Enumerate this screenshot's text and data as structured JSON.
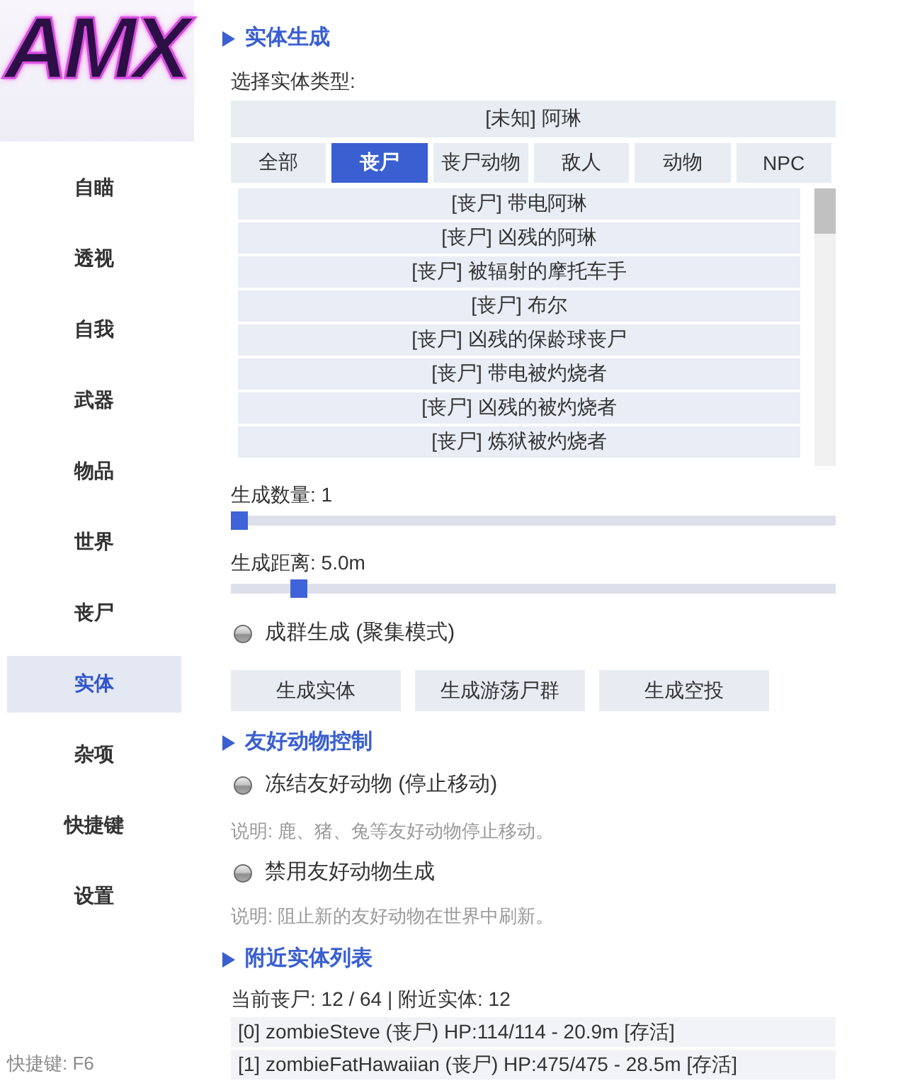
{
  "logo": {
    "text": "AMX"
  },
  "sidebar": {
    "items": [
      {
        "label": "自瞄",
        "selected": false
      },
      {
        "label": "透视",
        "selected": false
      },
      {
        "label": "自我",
        "selected": false
      },
      {
        "label": "武器",
        "selected": false
      },
      {
        "label": "物品",
        "selected": false
      },
      {
        "label": "世界",
        "selected": false
      },
      {
        "label": "丧尸",
        "selected": false
      },
      {
        "label": "实体",
        "selected": true
      },
      {
        "label": "杂项",
        "selected": false
      },
      {
        "label": "快捷键",
        "selected": false
      },
      {
        "label": "设置",
        "selected": false
      }
    ],
    "hotkey_hint": "快捷键: F6"
  },
  "spawn_section": {
    "title": "实体生成",
    "type_label": "选择实体类型:",
    "current_selection": "[未知] 阿琳",
    "tabs": [
      {
        "label": "全部",
        "selected": false
      },
      {
        "label": "丧尸",
        "selected": true
      },
      {
        "label": "丧尸动物",
        "selected": false
      },
      {
        "label": "敌人",
        "selected": false
      },
      {
        "label": "动物",
        "selected": false
      },
      {
        "label": "NPC",
        "selected": false
      }
    ],
    "entities": [
      {
        "label": "[丧尸] 带电阿琳",
        "selected": false
      },
      {
        "label": "[丧尸] 凶残的阿琳",
        "selected": false
      },
      {
        "label": "[丧尸] 被辐射的摩托车手",
        "selected": false
      },
      {
        "label": "[丧尸] 布尔",
        "selected": false
      },
      {
        "label": "[丧尸] 凶残的保龄球丧尸",
        "selected": false
      },
      {
        "label": "[丧尸] 带电被灼烧者",
        "selected": false
      },
      {
        "label": "[丧尸] 凶残的被灼烧者",
        "selected": false
      },
      {
        "label": "[丧尸] 炼狱被灼烧者",
        "selected": false
      }
    ],
    "sliders": [
      {
        "label": "生成数量: 1",
        "level": 0
      },
      {
        "label": "生成距离: 5.0m",
        "level": 0.1
      }
    ],
    "options": [
      {
        "label": "成群生成 (聚集模式)",
        "checked": false
      }
    ],
    "buttons": [
      "生成实体",
      "生成游荡尸群",
      "生成空投"
    ]
  },
  "friendly_section": {
    "title": "友好动物控制",
    "options": [
      {
        "label": "冻结友好动物 (停止移动)",
        "checked": false,
        "note": "说明: 鹿、猪、兔等友好动物停止移动。"
      },
      {
        "label": "禁用友好动物生成",
        "checked": false,
        "note": "说明: 阻止新的友好动物在世界中刷新。"
      }
    ]
  },
  "nearby_section": {
    "title": "附近实体列表",
    "summary": "当前丧尸: 12 / 64 | 附近实体: 12",
    "rows": [
      "[0] zombieSteve (丧尸) HP:114/114 - 20.9m [存活]",
      "[1] zombieFatHawaiian (丧尸) HP:475/475 - 28.5m [存活]"
    ]
  }
}
